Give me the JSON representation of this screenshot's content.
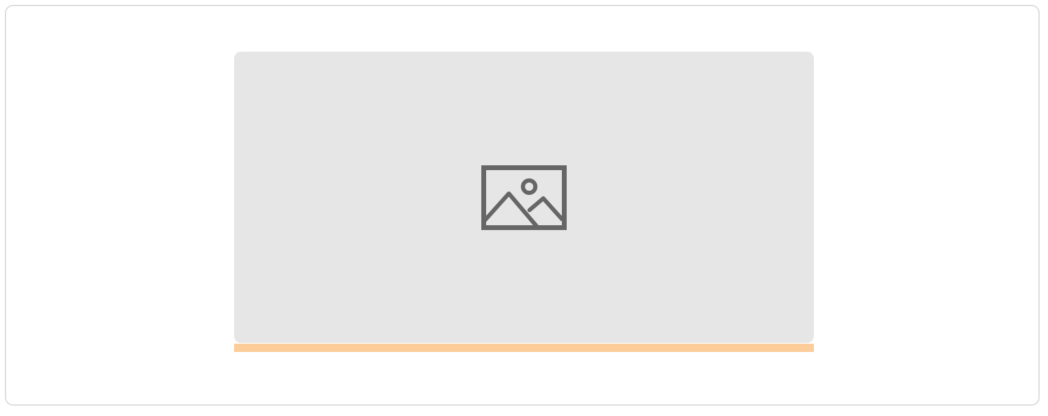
{
  "card": {
    "placeholder_icon": "image-placeholder-icon",
    "background_color": "#e6e6e6",
    "icon_color": "#666666"
  },
  "accent_bar": {
    "color": "#fccc99"
  },
  "frame": {
    "border_color": "#dedede"
  }
}
